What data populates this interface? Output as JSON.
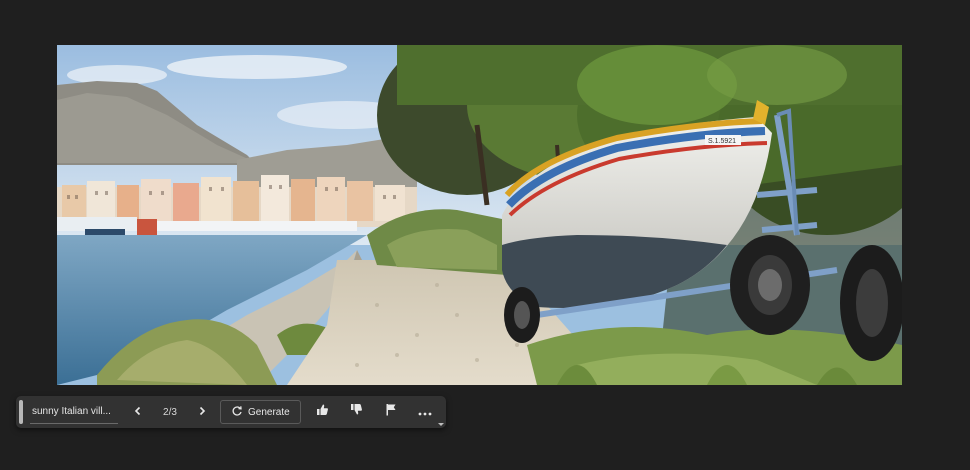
{
  "taskbar": {
    "prompt_text": "sunny Italian vill...",
    "page_counter": "2/3",
    "generate_label": "Generate"
  },
  "image": {
    "boat_registration": "S.1.5921"
  },
  "icons": {
    "previous": "chevron-left-icon",
    "next": "chevron-right-icon",
    "generate": "refresh-icon",
    "thumbs_up": "thumbs-up-icon",
    "thumbs_down": "thumbs-down-icon",
    "flag": "flag-icon",
    "more": "more-icon"
  },
  "colors": {
    "app_background": "#1e1e1e",
    "taskbar_background": "#323232",
    "text": "#e8e8e8"
  }
}
